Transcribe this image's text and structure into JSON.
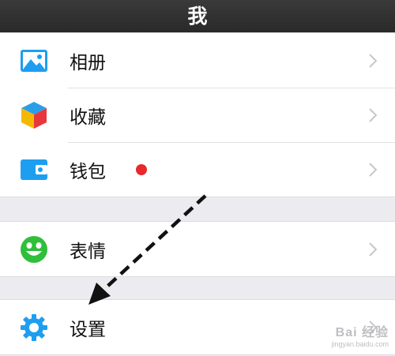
{
  "header": {
    "title": "我"
  },
  "groups": [
    {
      "items": [
        {
          "label": "相册",
          "icon": "photo-album-icon"
        },
        {
          "label": "收藏",
          "icon": "favorites-cube-icon"
        },
        {
          "label": "钱包",
          "icon": "wallet-icon",
          "badge": "red-dot"
        }
      ]
    },
    {
      "items": [
        {
          "label": "表情",
          "icon": "smiley-face-icon"
        }
      ]
    },
    {
      "items": [
        {
          "label": "设置",
          "icon": "gear-icon"
        }
      ]
    }
  ],
  "watermark": {
    "main": "Bai 经验",
    "sub": "jingyan.baidu.com"
  },
  "annotation": {
    "type": "dashed-arrow",
    "color": "#111111"
  },
  "colors": {
    "header_bg": "#2d2d2d",
    "icon_blue": "#1e9ef0",
    "icon_green": "#2fbf3a",
    "badge_red": "#e8282c",
    "background": "#ececf0"
  }
}
